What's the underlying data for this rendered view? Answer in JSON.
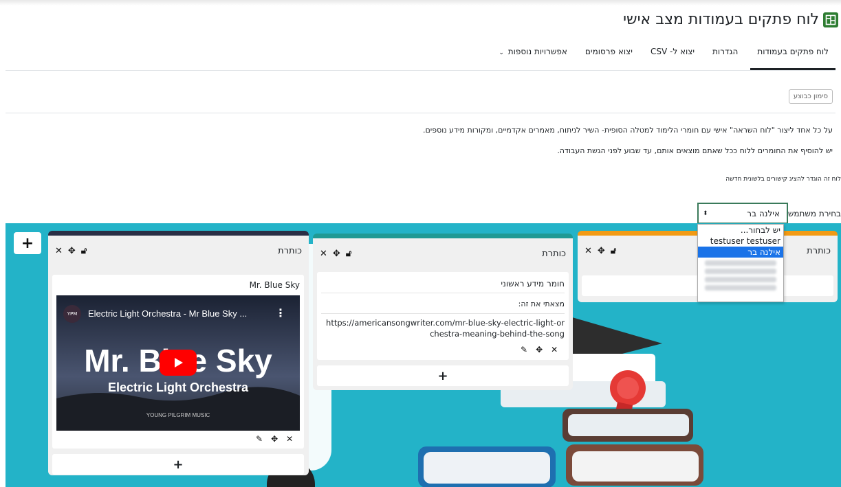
{
  "page": {
    "title": "לוח פתקים בעמודות מצב אישי"
  },
  "tabs": [
    {
      "label": "לוח פתקים בעמודות"
    },
    {
      "label": "הגדרות"
    },
    {
      "label": "יצוא ל- CSV"
    },
    {
      "label": "יצוא פרסומים"
    },
    {
      "label": "אפשרויות נוספות"
    }
  ],
  "mark_done": "סימון כבוצע",
  "intro": {
    "line1": "על כל אחד ליצור \"לוח השראה\" אישי עם חומרי הלימוד למטלה הסופית- השיר לניתוח, מאמרים אקדמיים, ומקורות מידע נוספים.",
    "line2": "יש להוסיף את החומרים ללוח ככל שאתם מוצאים אותם, עד שבוע לפני הגשת העבודה.",
    "note": "לוח זה הוגדר להציג קישורים בלשונית חדשה"
  },
  "user_select": {
    "label": "בחירת משתמש",
    "value": "אילנה בר",
    "options": [
      "יש לבחור...",
      "testuser testuser",
      "אילנה בר"
    ]
  },
  "columns": [
    {
      "title": "כותרת",
      "color": "#f29a14",
      "notes": []
    },
    {
      "title": "כותרת",
      "color": "#1f9a94",
      "notes": [
        {
          "title": "חומר מידע ראשוני",
          "text": "מצאתי את זה:",
          "link": "https://americansongwriter.com/mr-blue-sky-electric-light-orchestra-meaning-behind-the-song"
        }
      ]
    },
    {
      "title": "כותרת",
      "color": "#2a2e45",
      "notes": [
        {
          "title": "Mr. Blue Sky"
        }
      ]
    }
  ],
  "video": {
    "channel": "YPM",
    "title": "Electric Light Orchestra - Mr Blue Sky ...",
    "big_text": "Mr. Blue Sky",
    "sub_text": "Electric Light Orchestra",
    "footer": "YOUNG PILGRIM MUSIC"
  },
  "colors": {
    "board": "#23b3c8",
    "accent": "#3a7a5a"
  }
}
